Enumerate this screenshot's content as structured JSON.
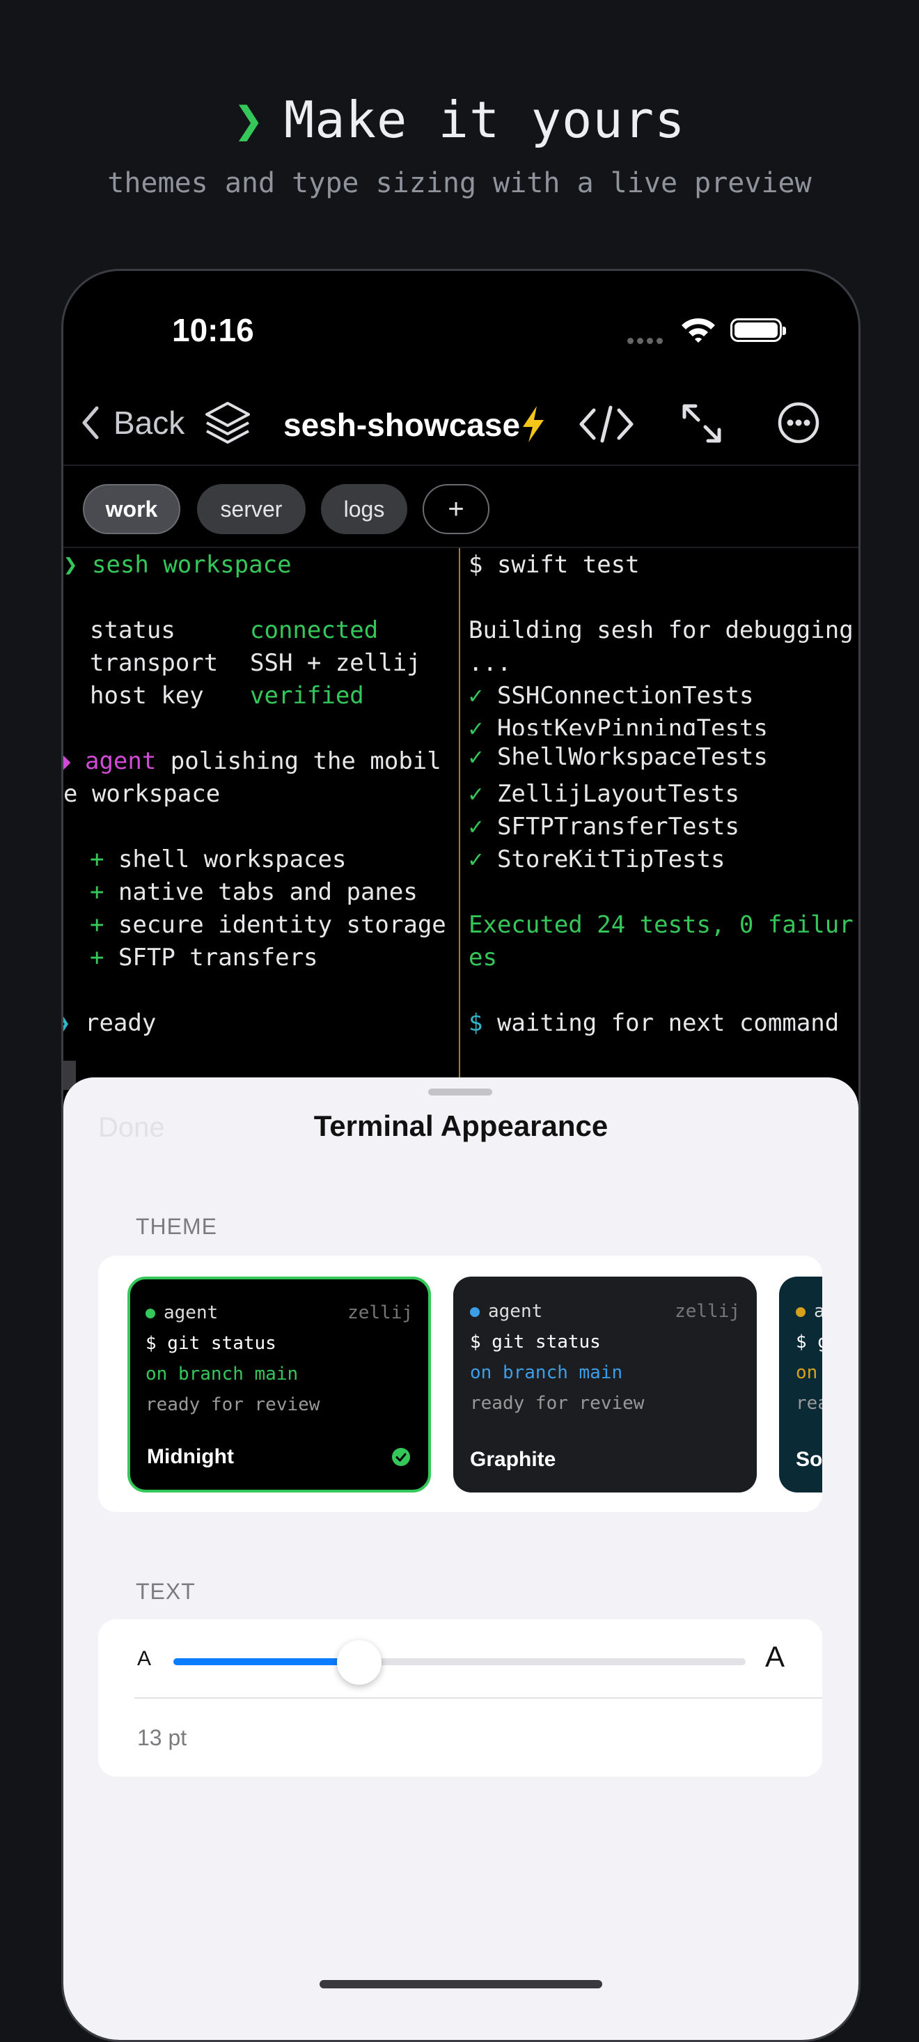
{
  "hero": {
    "chevron": "❯",
    "title": "Make it yours",
    "subtitle": "themes and type sizing with a live preview"
  },
  "status_bar": {
    "time": "10:16"
  },
  "nav": {
    "back_label": "Back",
    "title": "sesh-showcase",
    "bolt_color": "#f5c518"
  },
  "tabs": [
    {
      "label": "work",
      "active": true
    },
    {
      "label": "server"
    },
    {
      "label": "logs"
    },
    {
      "label": "+"
    }
  ],
  "terminal_left": {
    "prompt1": "❯",
    "cmd1": "sesh workspace",
    "status_key": "status",
    "status_val": "connected",
    "transport_key": "transport",
    "transport_val": "SSH + zellij",
    "hostkey_key": "host key",
    "hostkey_val": "verified",
    "agent_marker": "◆",
    "agent_word": "agent",
    "agent_rest": " polishing the mobil",
    "agent_wrap": "e workspace",
    "items": [
      "+ shell workspaces",
      "+ native tabs and panes",
      "+ secure identity storage",
      "+ SFTP transfers"
    ],
    "prompt2": "❯",
    "ready": "ready"
  },
  "terminal_right": {
    "cmd": "$ swift test",
    "building": "Building sesh for debugging",
    "ellipsis": "...",
    "tests": [
      "✓ SSHConnectionTests",
      "✓ HostKeyPinningTests",
      "✓ ShellWorkspaceTests",
      "✓ ZellijLayoutTests",
      "✓ SFTPTransferTests",
      "✓ StoreKitTipTests"
    ],
    "executed": "Executed 24 tests, 0 failur",
    "executed_wrap": "es",
    "waiting_prompt": "$",
    "waiting": " waiting for next command"
  },
  "sheet": {
    "done_label": "Done",
    "title": "Terminal Appearance",
    "theme_section": "THEME",
    "themes": [
      {
        "agent": "agent",
        "tag": "zellij",
        "cmd": "$ git status",
        "branch": "on branch main",
        "review": "ready for review",
        "name": "Midnight",
        "selected": true,
        "dot_color": "#35c759",
        "branch_color": "#35c759",
        "bg": "#000000"
      },
      {
        "agent": "agent",
        "tag": "zellij",
        "cmd": "$ git status",
        "branch": "on branch main",
        "review": "ready for review",
        "name": "Graphite",
        "selected": false,
        "dot_color": "#3d9ee8",
        "branch_color": "#3d9ee8",
        "bg": "#1c1d20"
      },
      {
        "agent": "a",
        "cmd": "$ g",
        "branch": "on",
        "review": "rea",
        "name": "So",
        "dot_color": "#d6a21e",
        "branch_color": "#d6a21e",
        "bg": "#0a2a36"
      }
    ],
    "text_section": "TEXT",
    "slider_small_label": "A",
    "slider_large_label": "A",
    "slider_fraction": 0.325,
    "size_label": "13 pt"
  }
}
